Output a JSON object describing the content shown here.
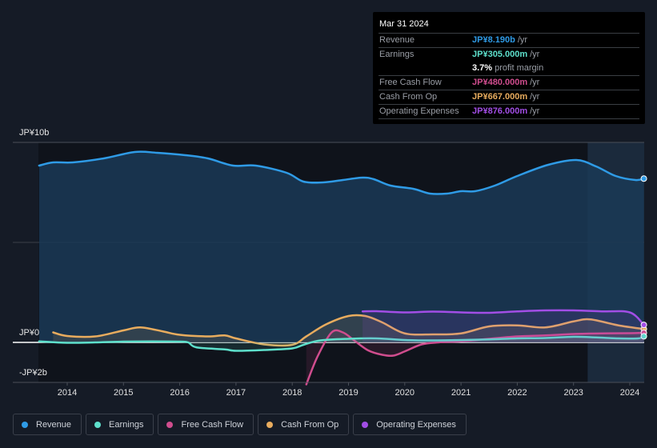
{
  "tooltip": {
    "date": "Mar 31 2024",
    "rows": [
      {
        "label": "Revenue",
        "value": "JP¥8.190b",
        "unit": "/yr",
        "color": "#2f9be6"
      },
      {
        "label": "Earnings",
        "value": "JP¥305.000m",
        "unit": "/yr",
        "color": "#5ee0cc"
      },
      {
        "label": "",
        "value": "3.7%",
        "unit": "profit margin",
        "color": "#ffffff"
      },
      {
        "label": "Free Cash Flow",
        "value": "JP¥480.000m",
        "unit": "/yr",
        "color": "#d04d8e"
      },
      {
        "label": "Cash From Op",
        "value": "JP¥667.000m",
        "unit": "/yr",
        "color": "#e8ac5e"
      },
      {
        "label": "Operating Expenses",
        "value": "JP¥876.000m",
        "unit": "/yr",
        "color": "#a24ee6"
      }
    ]
  },
  "legend": [
    {
      "label": "Revenue",
      "color": "#2f9be6"
    },
    {
      "label": "Earnings",
      "color": "#5ee0cc"
    },
    {
      "label": "Free Cash Flow",
      "color": "#d04d8e"
    },
    {
      "label": "Cash From Op",
      "color": "#e8ac5e"
    },
    {
      "label": "Operating Expenses",
      "color": "#a24ee6"
    }
  ],
  "chart_data": {
    "type": "line",
    "title": "",
    "xlabel": "",
    "ylabel": "",
    "y_tick_labels": [
      "JP¥10b",
      "JP¥0",
      "-JP¥2b"
    ],
    "y_ticks": [
      10,
      0,
      -2
    ],
    "ylim": [
      -2,
      10
    ],
    "xlim": [
      2013.5,
      2024.25
    ],
    "x_tick_labels": [
      "2014",
      "2015",
      "2016",
      "2017",
      "2018",
      "2019",
      "2020",
      "2021",
      "2022",
      "2023",
      "2024"
    ],
    "x_ticks": [
      2014,
      2015,
      2016,
      2017,
      2018,
      2019,
      2020,
      2021,
      2022,
      2023,
      2024
    ],
    "units": "JP¥ billions",
    "highlight_from": 2023.25,
    "grid": true,
    "legend_position": "bottom",
    "series": [
      {
        "name": "Revenue",
        "color": "#2f9be6",
        "fill": true,
        "x": [
          2013.5,
          2013.75,
          2014.1,
          2014.65,
          2015.2,
          2015.6,
          2016.1,
          2016.5,
          2016.95,
          2017.35,
          2017.9,
          2018.2,
          2018.55,
          2018.9,
          2019.25,
          2019.45,
          2019.75,
          2020.15,
          2020.45,
          2020.75,
          2021.0,
          2021.25,
          2021.6,
          2022.0,
          2022.55,
          2023.05,
          2023.4,
          2023.75,
          2024.1,
          2024.25
        ],
        "values": [
          8.84,
          9.0,
          9.0,
          9.2,
          9.52,
          9.48,
          9.36,
          9.2,
          8.84,
          8.84,
          8.48,
          8.04,
          8.0,
          8.12,
          8.24,
          8.16,
          7.84,
          7.68,
          7.44,
          7.44,
          7.56,
          7.56,
          7.84,
          8.32,
          8.88,
          9.12,
          8.8,
          8.32,
          8.12,
          8.19
        ]
      },
      {
        "name": "Earnings",
        "color": "#5ee0cc",
        "x": [
          2013.5,
          2014.0,
          2014.5,
          2015.0,
          2015.5,
          2016.0,
          2016.15,
          2016.3,
          2016.8,
          2017.0,
          2017.5,
          2018.0,
          2018.2,
          2018.5,
          2019.0,
          2019.5,
          2020.0,
          2020.5,
          2021.0,
          2021.5,
          2022.0,
          2022.5,
          2023.0,
          2023.4,
          2023.8,
          2024.15,
          2024.25
        ],
        "values": [
          0.05,
          -0.02,
          0.0,
          0.04,
          0.05,
          0.04,
          0.0,
          -0.25,
          -0.35,
          -0.42,
          -0.38,
          -0.3,
          -0.12,
          0.1,
          0.18,
          0.2,
          0.12,
          0.1,
          0.12,
          0.15,
          0.2,
          0.22,
          0.28,
          0.25,
          0.2,
          0.2,
          0.305
        ]
      },
      {
        "name": "Free Cash Flow",
        "color": "#d04d8e",
        "x": [
          2018.25,
          2018.45,
          2018.7,
          2018.9,
          2019.1,
          2019.35,
          2019.6,
          2019.8,
          2020.0,
          2020.3,
          2020.6,
          2021.0,
          2021.5,
          2022.0,
          2022.5,
          2023.0,
          2023.5,
          2024.0,
          2024.25
        ],
        "values": [
          -2.1,
          -0.7,
          0.5,
          0.5,
          0.1,
          -0.4,
          -0.62,
          -0.66,
          -0.45,
          -0.1,
          0.0,
          0.05,
          0.18,
          0.3,
          0.35,
          0.42,
          0.45,
          0.46,
          0.48
        ]
      },
      {
        "name": "Cash From Op",
        "color": "#e8ac5e",
        "x": [
          2013.75,
          2014.0,
          2014.5,
          2015.0,
          2015.3,
          2015.7,
          2016.0,
          2016.5,
          2016.8,
          2017.0,
          2017.5,
          2018.0,
          2018.25,
          2018.6,
          2019.0,
          2019.3,
          2019.6,
          2020.0,
          2020.5,
          2021.0,
          2021.5,
          2022.0,
          2022.5,
          2023.0,
          2023.3,
          2023.8,
          2024.25
        ],
        "values": [
          0.5,
          0.32,
          0.3,
          0.6,
          0.75,
          0.55,
          0.38,
          0.3,
          0.35,
          0.2,
          -0.1,
          -0.12,
          0.3,
          0.9,
          1.32,
          1.32,
          1.0,
          0.45,
          0.4,
          0.45,
          0.8,
          0.85,
          0.75,
          1.05,
          1.15,
          0.85,
          0.667
        ]
      },
      {
        "name": "Operating Expenses",
        "color": "#a24ee6",
        "x": [
          2019.25,
          2019.5,
          2020.0,
          2020.5,
          2021.0,
          2021.5,
          2022.0,
          2022.5,
          2023.0,
          2023.5,
          2024.0,
          2024.25
        ],
        "values": [
          1.55,
          1.56,
          1.5,
          1.54,
          1.5,
          1.48,
          1.55,
          1.6,
          1.6,
          1.55,
          1.5,
          0.876
        ]
      }
    ]
  }
}
